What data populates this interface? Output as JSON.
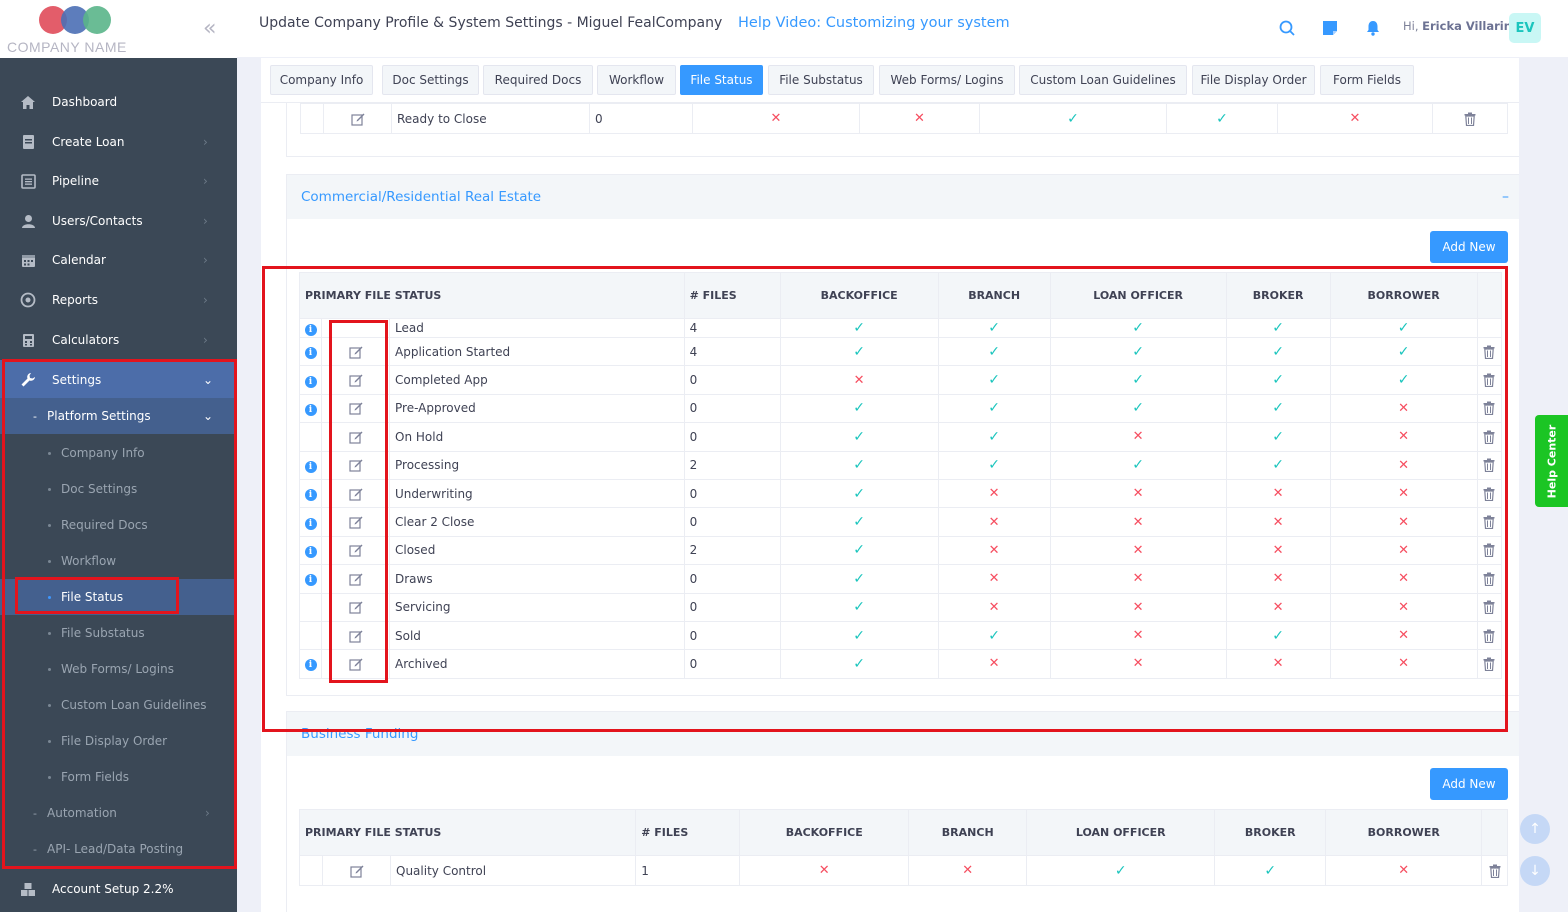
{
  "logo": {
    "text": "COMPANY NAME"
  },
  "header": {
    "title": "Update Company Profile & System Settings - Miguel FealCompany",
    "help_video": "Help Video: Customizing your system",
    "greeting_prefix": "Hi,",
    "user_name": "Ericka Villarin",
    "avatar_initials": "EV"
  },
  "sidebar": {
    "items": [
      {
        "label": "Dashboard",
        "icon": "home-icon"
      },
      {
        "label": "Create Loan",
        "icon": "document-icon"
      },
      {
        "label": "Pipeline",
        "icon": "list-icon"
      },
      {
        "label": "Users/Contacts",
        "icon": "user-icon"
      },
      {
        "label": "Calendar",
        "icon": "calendar-icon"
      },
      {
        "label": "Reports",
        "icon": "chart-icon"
      },
      {
        "label": "Calculators",
        "icon": "calculator-icon"
      }
    ],
    "settings_label": "Settings",
    "platform_settings_label": "Platform Settings",
    "sub_items": [
      "Company Info",
      "Doc Settings",
      "Required Docs",
      "Workflow",
      "File Status",
      "File Substatus",
      "Web Forms/ Logins",
      "Custom Loan Guidelines",
      "File Display Order",
      "Form Fields"
    ],
    "automation_label": "Automation",
    "api_label": "API- Lead/Data Posting",
    "account_setup_label": "Account Setup 2.2%"
  },
  "tabs": [
    "Company Info",
    "Doc Settings",
    "Required Docs",
    "Workflow",
    "File Status",
    "File Substatus",
    "Web Forms/ Logins",
    "Custom Loan Guidelines",
    "File Display Order",
    "Form Fields"
  ],
  "active_tab": "File Status",
  "top_row": {
    "status": "Ready to Close",
    "files": "0",
    "perms": [
      false,
      false,
      true,
      true,
      false
    ]
  },
  "section_cre": {
    "title": "Commercial/Residential Real Estate",
    "collapse_symbol": "–",
    "add_new": "Add New",
    "headers": [
      "PRIMARY FILE STATUS",
      "# FILES",
      "BACKOFFICE",
      "BRANCH",
      "LOAN OFFICER",
      "BROKER",
      "BORROWER"
    ],
    "rows": [
      {
        "status": "Lead",
        "files": "4",
        "info": true,
        "edit": false,
        "del": false,
        "perms": [
          true,
          true,
          true,
          true,
          true
        ]
      },
      {
        "status": "Application Started",
        "files": "4",
        "info": true,
        "edit": true,
        "del": true,
        "perms": [
          true,
          true,
          true,
          true,
          true
        ]
      },
      {
        "status": "Completed App",
        "files": "0",
        "info": true,
        "edit": true,
        "del": true,
        "perms": [
          false,
          true,
          true,
          true,
          true
        ]
      },
      {
        "status": "Pre-Approved",
        "files": "0",
        "info": true,
        "edit": true,
        "del": true,
        "perms": [
          true,
          true,
          true,
          true,
          false
        ]
      },
      {
        "status": "On Hold",
        "files": "0",
        "info": false,
        "edit": true,
        "del": true,
        "perms": [
          true,
          true,
          false,
          true,
          false
        ]
      },
      {
        "status": "Processing",
        "files": "2",
        "info": true,
        "edit": true,
        "del": true,
        "perms": [
          true,
          true,
          true,
          true,
          false
        ]
      },
      {
        "status": "Underwriting",
        "files": "0",
        "info": true,
        "edit": true,
        "del": true,
        "perms": [
          true,
          false,
          false,
          false,
          false
        ]
      },
      {
        "status": "Clear 2 Close",
        "files": "0",
        "info": true,
        "edit": true,
        "del": true,
        "perms": [
          true,
          false,
          false,
          false,
          false
        ]
      },
      {
        "status": "Closed",
        "files": "2",
        "info": true,
        "edit": true,
        "del": true,
        "perms": [
          true,
          false,
          false,
          false,
          false
        ]
      },
      {
        "status": "Draws",
        "files": "0",
        "info": true,
        "edit": true,
        "del": true,
        "perms": [
          true,
          false,
          false,
          false,
          false
        ]
      },
      {
        "status": "Servicing",
        "files": "0",
        "info": false,
        "edit": true,
        "del": true,
        "perms": [
          true,
          false,
          false,
          false,
          false
        ]
      },
      {
        "status": "Sold",
        "files": "0",
        "info": false,
        "edit": true,
        "del": true,
        "perms": [
          true,
          true,
          false,
          true,
          false
        ]
      },
      {
        "status": "Archived",
        "files": "0",
        "info": true,
        "edit": true,
        "del": true,
        "perms": [
          true,
          false,
          false,
          false,
          false
        ]
      }
    ]
  },
  "section_bf": {
    "title": "Business Funding",
    "add_new": "Add New",
    "headers": [
      "PRIMARY FILE STATUS",
      "# FILES",
      "BACKOFFICE",
      "BRANCH",
      "LOAN OFFICER",
      "BROKER",
      "BORROWER"
    ],
    "rows": [
      {
        "status": "Quality Control",
        "files": "1",
        "perms": [
          false,
          false,
          true,
          true,
          false
        ]
      }
    ]
  },
  "help_center": "Help Center",
  "colors": {
    "accent": "#3699ff",
    "check": "#1bc5bd",
    "cross": "#f64e60",
    "sidebar": "#3b4856",
    "highlight": "#e3141d"
  }
}
